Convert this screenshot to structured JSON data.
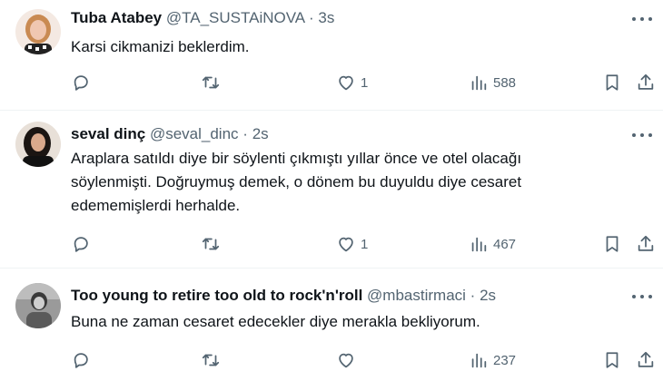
{
  "tweets": [
    {
      "name": "Tuba Atabey",
      "handle": "@TA_SUSTAiNOVA",
      "separator": "·",
      "time": "3s",
      "text": "Karsi cikmanizi beklerdim.",
      "likes": "1",
      "views": "588",
      "avatar_colors": {
        "bg": "#f4e9e2",
        "hair": "#c98a52",
        "skin": "#f0c7b1",
        "shirt": "#222222"
      }
    },
    {
      "name": "seval dinç",
      "handle": "@seval_dinc",
      "separator": "·",
      "time": "2s",
      "text_lines": [
        "Araplara satıldı diye bir söylenti çıkmıştı yıllar önce ve otel olacağı",
        "söylenmişti. Doğruymuş demek, o dönem bu duyuldu diye cesaret",
        "edememişlerdi herhalde."
      ],
      "likes": "1",
      "views": "467",
      "avatar_colors": {
        "bg": "#e8e0d8",
        "hair": "#1b1512",
        "skin": "#d9a98c",
        "shirt": "#111111"
      }
    },
    {
      "name": "Too young to retire too old to rock'n'roll",
      "handle": "@mbastirmaci",
      "separator": "·",
      "time": "2s",
      "text": "Buna ne zaman cesaret edecekler diye merakla bekliyorum.",
      "views": "237",
      "avatar_colors": {
        "bg": "#9a9a9a",
        "hair": "#3a3a3a",
        "skin": "#cfcfcf",
        "shirt": "#5a5a5a"
      }
    }
  ],
  "icons": {
    "reply": "reply-icon",
    "retweet": "retweet-icon",
    "like": "heart-icon",
    "views": "views-icon",
    "bookmark": "bookmark-icon",
    "share": "share-icon",
    "more": "more-icon"
  },
  "colors": {
    "text_primary": "#0f1419",
    "text_secondary": "#536471",
    "divider": "#eff3f4"
  }
}
